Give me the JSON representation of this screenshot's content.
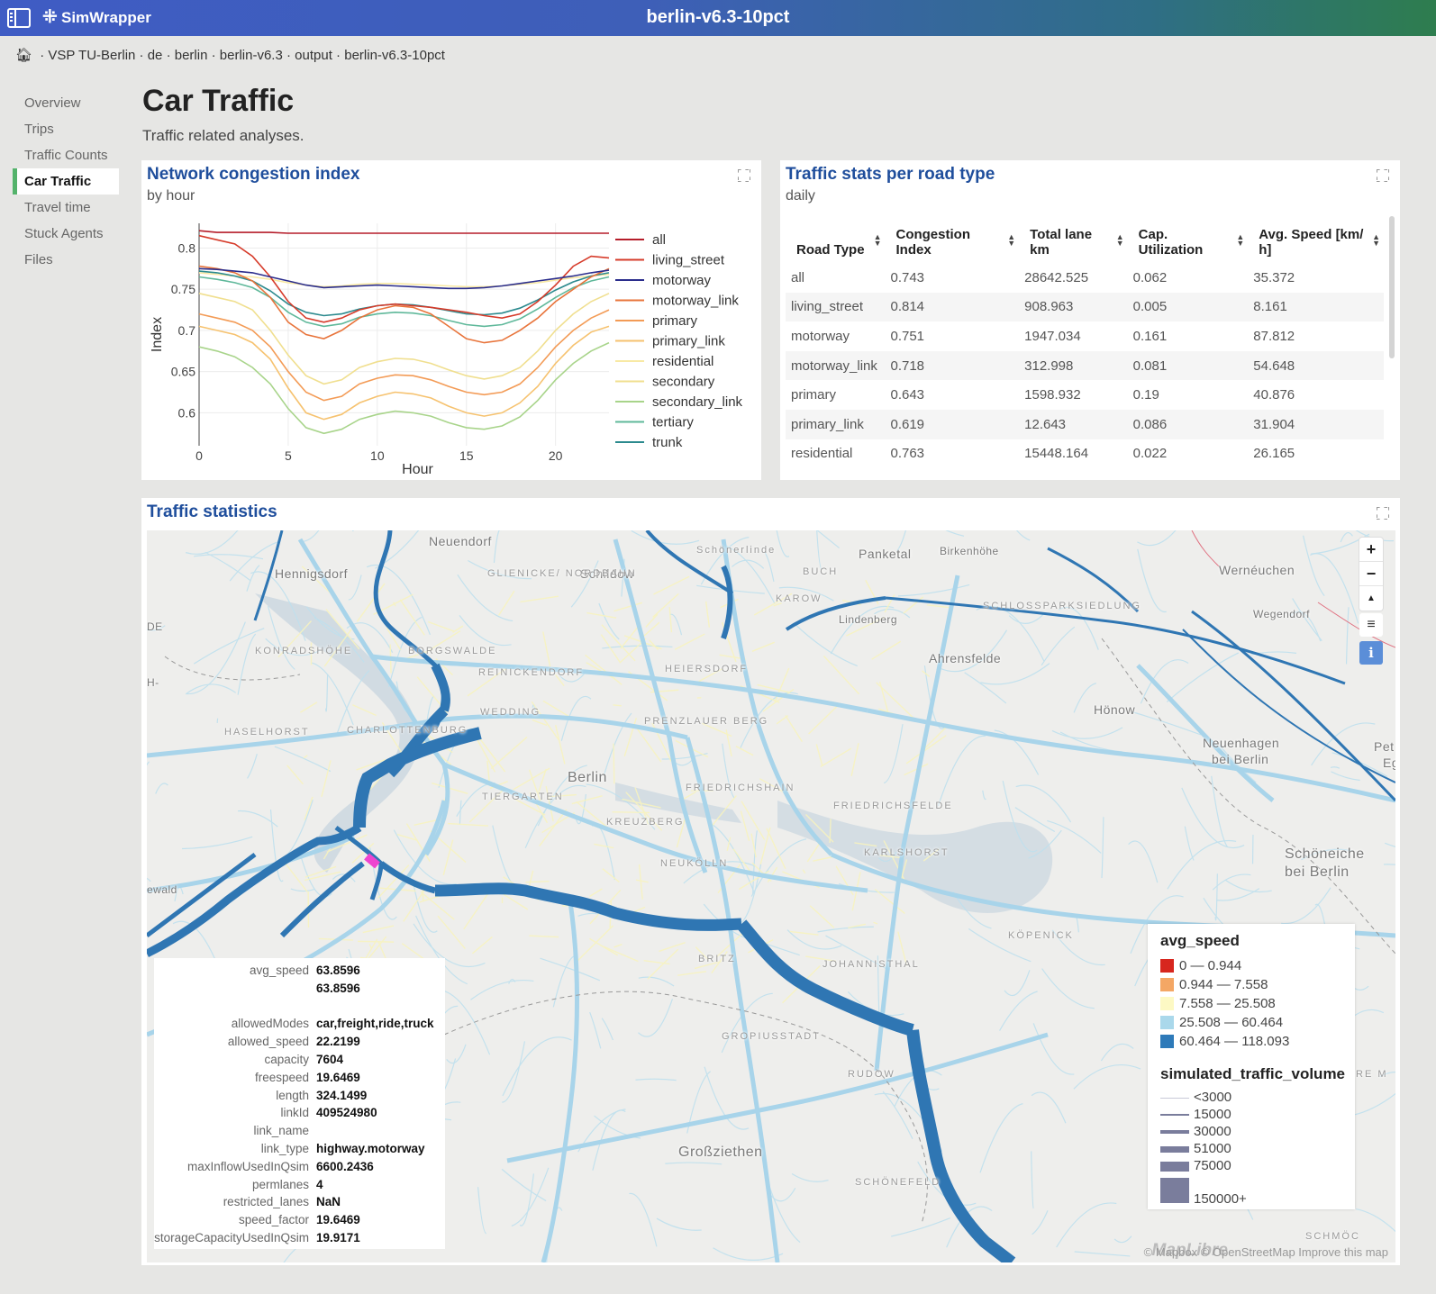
{
  "app": {
    "brand": "SimWrapper",
    "window_title": "berlin-v6.3-10pct"
  },
  "breadcrumb": [
    "VSP TU-Berlin",
    "de",
    "berlin",
    "berlin-v6.3",
    "output",
    "berlin-v6.3-10pct"
  ],
  "sidebar": {
    "items": [
      {
        "label": "Overview"
      },
      {
        "label": "Trips"
      },
      {
        "label": "Traffic Counts"
      },
      {
        "label": "Car Traffic",
        "active": true
      },
      {
        "label": "Travel time"
      },
      {
        "label": "Stuck Agents"
      },
      {
        "label": "Files"
      }
    ]
  },
  "page": {
    "title": "Car Traffic",
    "description": "Traffic related analyses."
  },
  "congestion_card": {
    "title": "Network congestion index",
    "subtitle": "by hour"
  },
  "stats_card": {
    "title": "Traffic stats per road type",
    "subtitle": "daily",
    "columns": [
      "Road Type",
      "Congestion Index",
      "Total lane km",
      "Cap. Utilization",
      "Avg. Speed [km/h]"
    ],
    "column_lines": [
      [
        "Road Type"
      ],
      [
        "Congestion",
        "Index"
      ],
      [
        "Total lane",
        "km"
      ],
      [
        "Cap.",
        "Utilization"
      ],
      [
        "Avg. Speed [km/",
        "h]"
      ]
    ],
    "rows": [
      [
        "all",
        "0.743",
        "28642.525",
        "0.062",
        "35.372"
      ],
      [
        "living_street",
        "0.814",
        "908.963",
        "0.005",
        "8.161"
      ],
      [
        "motorway",
        "0.751",
        "1947.034",
        "0.161",
        "87.812"
      ],
      [
        "motorway_link",
        "0.718",
        "312.998",
        "0.081",
        "54.648"
      ],
      [
        "primary",
        "0.643",
        "1598.932",
        "0.19",
        "40.876"
      ],
      [
        "primary_link",
        "0.619",
        "12.643",
        "0.086",
        "31.904"
      ],
      [
        "residential",
        "0.763",
        "15448.164",
        "0.022",
        "26.165"
      ]
    ]
  },
  "map_card": {
    "title": "Traffic statistics",
    "places": [
      "Neuendorf",
      "Hennigsdorf",
      "Schildow",
      "Panketal",
      "Birkenhöhe",
      "Wernéuchen",
      "Wegendorf",
      "Ahrensfelde",
      "Hönow",
      "Neuenhagen",
      "bei Berlin",
      "Schöneiche",
      "bei Berlin",
      "Berlin",
      "Großziethen",
      "Lindenberg",
      "Pet",
      "Eg",
      "ewald",
      "DE",
      "H-"
    ],
    "districts": [
      "Schönerlinde",
      "GLIENICKE/ NORDBAHN",
      "BUCH",
      "KAROW",
      "SCHLOSSPARKSIEDLUNG",
      "KONRADSHÖHE",
      "BORGSWALDE",
      "REINICKENDORF",
      "HEIERSDORF",
      "WEDDING",
      "CHARLOTTENBURG",
      "HASELHORST",
      "PRENZLAUER BERG",
      "TIERGARTEN",
      "FRIEDRICHSHAIN",
      "FRIEDRICHSFELDE",
      "KREUZBERG",
      "KARLSHORST",
      "NEUKÖLLN",
      "KÖPENICK",
      "JOHANNISTHAL",
      "BRITZ",
      "GROPIUSSTADT",
      "RUDOW",
      "SCHÖNEFELD",
      "SCHMÖC",
      "RE M"
    ],
    "controls": {
      "zoom_in": "+",
      "zoom_out": "−",
      "compass": "▲",
      "filter": "≡",
      "info": "i"
    },
    "attribution": "© Mapbox © OpenStreetMap  Improve this map",
    "logo": "MapLibre",
    "tooltip": [
      {
        "key": "avg_speed",
        "value": "63.8596"
      },
      {
        "key": "",
        "value": "63.8596"
      },
      {
        "key": "",
        "value": ""
      },
      {
        "key": "allowedModes",
        "value": "car,freight,ride,truck"
      },
      {
        "key": "allowed_speed",
        "value": "22.2199"
      },
      {
        "key": "capacity",
        "value": "7604"
      },
      {
        "key": "freespeed",
        "value": "19.6469"
      },
      {
        "key": "length",
        "value": "324.1499"
      },
      {
        "key": "linkId",
        "value": "409524980"
      },
      {
        "key": "link_name",
        "value": ""
      },
      {
        "key": "link_type",
        "value": "highway.motorway"
      },
      {
        "key": "maxInflowUsedInQsim",
        "value": "6600.2436"
      },
      {
        "key": "permlanes",
        "value": "4"
      },
      {
        "key": "restricted_lanes",
        "value": "NaN"
      },
      {
        "key": "speed_factor",
        "value": "19.6469"
      },
      {
        "key": "storageCapacityUsedInQsim",
        "value": "19.9171"
      }
    ],
    "legend": {
      "color_title": "avg_speed",
      "color_bins": [
        {
          "label": "0 — 0.944",
          "color": "#d7261e"
        },
        {
          "label": "0.944 — 7.558",
          "color": "#f4a765"
        },
        {
          "label": "7.558 — 25.508",
          "color": "#fdf9c4"
        },
        {
          "label": "25.508 — 60.464",
          "color": "#aad8eb"
        },
        {
          "label": "60.464 — 118.093",
          "color": "#2e7ab9"
        }
      ],
      "width_title": "simulated_traffic_volume",
      "width_bins": [
        "<3000",
        "15000",
        "30000",
        "51000",
        "75000",
        "150000+"
      ]
    }
  },
  "chart_data": {
    "type": "line",
    "title": "Network congestion index",
    "subtitle": "by hour",
    "xlabel": "Hour",
    "ylabel": "Index",
    "xlim": [
      0,
      23
    ],
    "ylim": [
      0.56,
      0.83
    ],
    "xticks": [
      0,
      5,
      10,
      15,
      20
    ],
    "yticks": [
      0.6,
      0.65,
      0.7,
      0.75,
      0.8
    ],
    "grid": true,
    "legend_position": "right",
    "x": [
      0,
      1,
      2,
      3,
      4,
      5,
      6,
      7,
      8,
      9,
      10,
      11,
      12,
      13,
      14,
      15,
      16,
      17,
      18,
      19,
      20,
      21,
      22,
      23
    ],
    "series": [
      {
        "name": "all",
        "color": "#b51d2a",
        "values": [
          0.821,
          0.819,
          0.819,
          0.819,
          0.819,
          0.818,
          0.818,
          0.818,
          0.818,
          0.818,
          0.818,
          0.818,
          0.818,
          0.818,
          0.818,
          0.818,
          0.818,
          0.818,
          0.818,
          0.818,
          0.818,
          0.818,
          0.818,
          0.818
        ]
      },
      {
        "name": "living_street",
        "color": "#d63b2a",
        "values": [
          0.815,
          0.81,
          0.805,
          0.79,
          0.765,
          0.735,
          0.715,
          0.71,
          0.715,
          0.725,
          0.73,
          0.732,
          0.73,
          0.728,
          0.725,
          0.722,
          0.718,
          0.715,
          0.72,
          0.735,
          0.755,
          0.778,
          0.79,
          0.788
        ]
      },
      {
        "name": "motorway",
        "color": "#2b2d8c",
        "values": [
          0.775,
          0.774,
          0.772,
          0.77,
          0.765,
          0.76,
          0.755,
          0.752,
          0.753,
          0.754,
          0.755,
          0.754,
          0.753,
          0.752,
          0.751,
          0.751,
          0.752,
          0.754,
          0.757,
          0.76,
          0.763,
          0.766,
          0.77,
          0.773
        ]
      },
      {
        "name": "motorway_link",
        "color": "#e8743b",
        "values": [
          0.778,
          0.775,
          0.77,
          0.76,
          0.74,
          0.71,
          0.695,
          0.69,
          0.7,
          0.715,
          0.725,
          0.73,
          0.728,
          0.72,
          0.705,
          0.69,
          0.685,
          0.688,
          0.7,
          0.715,
          0.735,
          0.75,
          0.765,
          0.775
        ]
      },
      {
        "name": "primary",
        "color": "#f39b56",
        "values": [
          0.72,
          0.715,
          0.71,
          0.7,
          0.68,
          0.65,
          0.625,
          0.615,
          0.62,
          0.635,
          0.642,
          0.646,
          0.645,
          0.64,
          0.632,
          0.625,
          0.622,
          0.625,
          0.635,
          0.655,
          0.68,
          0.7,
          0.715,
          0.725
        ]
      },
      {
        "name": "primary_link",
        "color": "#f6c26f",
        "values": [
          0.705,
          0.7,
          0.695,
          0.685,
          0.665,
          0.63,
          0.6,
          0.592,
          0.598,
          0.612,
          0.62,
          0.625,
          0.623,
          0.618,
          0.608,
          0.6,
          0.596,
          0.6,
          0.612,
          0.632,
          0.66,
          0.682,
          0.698,
          0.705
        ]
      },
      {
        "name": "residential",
        "color": "#f8e9a4",
        "values": [
          0.77,
          0.768,
          0.766,
          0.765,
          0.762,
          0.758,
          0.755,
          0.753,
          0.754,
          0.756,
          0.757,
          0.757,
          0.756,
          0.755,
          0.754,
          0.753,
          0.753,
          0.754,
          0.756,
          0.758,
          0.761,
          0.764,
          0.766,
          0.768
        ]
      },
      {
        "name": "secondary",
        "color": "#f0df8f",
        "values": [
          0.745,
          0.74,
          0.735,
          0.725,
          0.7,
          0.67,
          0.645,
          0.635,
          0.64,
          0.655,
          0.662,
          0.666,
          0.665,
          0.66,
          0.652,
          0.645,
          0.641,
          0.645,
          0.655,
          0.675,
          0.7,
          0.72,
          0.735,
          0.745
        ]
      },
      {
        "name": "secondary_link",
        "color": "#a8d48a",
        "values": [
          0.68,
          0.675,
          0.668,
          0.655,
          0.635,
          0.605,
          0.582,
          0.575,
          0.58,
          0.592,
          0.598,
          0.602,
          0.6,
          0.596,
          0.588,
          0.582,
          0.58,
          0.584,
          0.595,
          0.615,
          0.64,
          0.66,
          0.675,
          0.685
        ]
      },
      {
        "name": "tertiary",
        "color": "#5fb89a",
        "values": [
          0.765,
          0.762,
          0.758,
          0.752,
          0.74,
          0.722,
          0.71,
          0.705,
          0.708,
          0.716,
          0.72,
          0.722,
          0.721,
          0.718,
          0.712,
          0.707,
          0.705,
          0.707,
          0.714,
          0.726,
          0.74,
          0.752,
          0.76,
          0.765
        ]
      },
      {
        "name": "trunk",
        "color": "#2c8a8e",
        "values": [
          0.772,
          0.77,
          0.766,
          0.76,
          0.748,
          0.732,
          0.722,
          0.718,
          0.72,
          0.726,
          0.73,
          0.732,
          0.731,
          0.728,
          0.724,
          0.72,
          0.719,
          0.721,
          0.727,
          0.737,
          0.749,
          0.759,
          0.766,
          0.77
        ]
      }
    ]
  }
}
